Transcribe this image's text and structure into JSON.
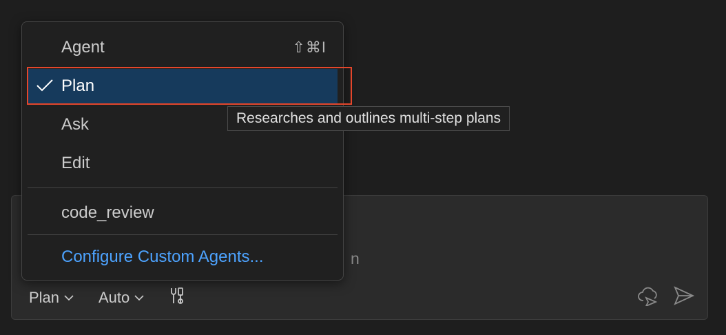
{
  "chat": {
    "input_residue": "n",
    "mode_picker_label": "Plan",
    "model_picker_label": "Auto",
    "tools_icon": "tools-icon",
    "cloud_icon": "cloud-delegate-icon",
    "send_icon": "send-icon"
  },
  "menu": {
    "items": [
      {
        "label": "Agent",
        "shortcut": "⇧⌘I",
        "selected": false
      },
      {
        "label": "Plan",
        "shortcut": "",
        "selected": true
      },
      {
        "label": "Ask",
        "shortcut": "",
        "selected": false
      },
      {
        "label": "Edit",
        "shortcut": "",
        "selected": false
      },
      {
        "label": "code_review",
        "shortcut": "",
        "selected": false
      }
    ],
    "configure_label": "Configure Custom Agents..."
  },
  "tooltip": {
    "text": "Researches and outlines multi-step plans"
  },
  "colors": {
    "selected_bg": "#163a5c",
    "highlight": "#e5462b",
    "link": "#4da3ff"
  }
}
